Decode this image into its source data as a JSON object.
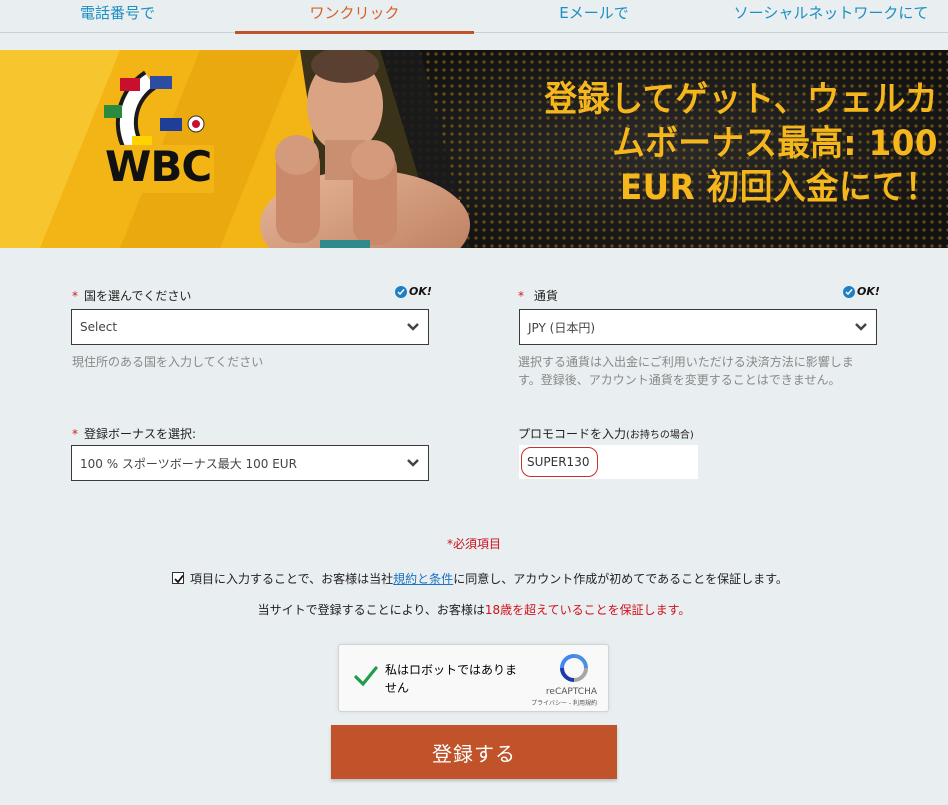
{
  "tabs": [
    {
      "label": "電話番号で",
      "active": false
    },
    {
      "label": "ワンクリック",
      "active": true
    },
    {
      "label": "Eメールで",
      "active": false
    },
    {
      "label": "ソーシャルネットワークにて",
      "active": false
    }
  ],
  "banner": {
    "logo_text": "WBC",
    "headline": "登録してゲット、ウェルカムボーナス最高: 100 EUR 初回入金にて！"
  },
  "form": {
    "country": {
      "label": "国を選んでください",
      "ok": "OK!",
      "value": "Select",
      "hint": "現住所のある国を入力してください"
    },
    "currency": {
      "label": "通貨",
      "ok": "OK!",
      "value": "JPY (日本円)",
      "hint": "選択する通貨は入出金にご利用いただける決済方法に影響しま す。登録後、アカウント通貨を変更することはできません。"
    },
    "bonus": {
      "label": "登録ボーナスを選択:",
      "value": "100 % スポーツボーナス最大 100 EUR"
    },
    "promo": {
      "label": "プロモコードを入力",
      "label_small": "(お持ちの場合)",
      "value": "SUPER130"
    },
    "required_marker": "*",
    "required_note": "*必須項目",
    "terms": {
      "before": "項目に入力することで、お客様は当社",
      "link": "規約と条件",
      "after": "に同意し、アカウント作成が初めてであることを保証します。",
      "checked": true
    },
    "age": {
      "before": "当サイトで登録することにより、お客様は",
      "highlight": "18歳を超えていることを保証します。"
    }
  },
  "captcha": {
    "label": "私はロボットではありません",
    "brand": "reCAPTCHA",
    "links": "プライバシー - 利用規約"
  },
  "submit_label": "登録する",
  "colors": {
    "accent": "#c0532a",
    "tab_active": "#d3622a",
    "tab_inactive": "#1b8fc1",
    "required": "#d0201b",
    "banner_yellow": "#f6b71c"
  }
}
